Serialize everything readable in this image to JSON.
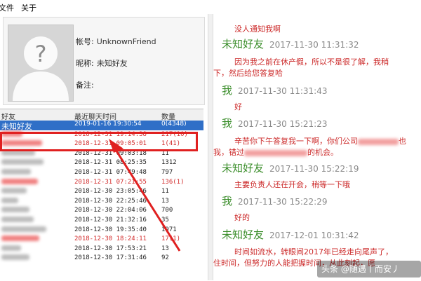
{
  "menu": {
    "file": "文件",
    "about": "关于"
  },
  "profile": {
    "account_label": "帐号:",
    "account_value": "UnknownFriend",
    "nickname_label": "昵称:",
    "nickname_value": "未知好友",
    "note_label": "备注:"
  },
  "table": {
    "columns": [
      "好友",
      "最近聊天时间",
      "数量"
    ],
    "rows": [
      {
        "name": "未知好友",
        "time": "2019-01-16 19:30:54",
        "count": "0(4348)",
        "selected": true
      },
      {
        "name": "",
        "time": "2018-12-31 19:14:38",
        "count": "217(10)",
        "red": true
      },
      {
        "name": "",
        "time": "2018-12-31 09:05:01",
        "count": "1(41)",
        "red": true
      },
      {
        "name": "",
        "time": "2018-12-31 09:03:18",
        "count": "11"
      },
      {
        "name": "",
        "time": "2018-12-31 08:25:35",
        "count": "1312"
      },
      {
        "name": "",
        "time": "2018-12-31 07:49:48",
        "count": "797"
      },
      {
        "name": "",
        "time": "2018-12-31 07:21:55",
        "count": "136(1)",
        "red": true
      },
      {
        "name": "",
        "time": "2018-12-30 23:05:46",
        "count": "11"
      },
      {
        "name": "",
        "time": "2018-12-30 22:25:46",
        "count": "13"
      },
      {
        "name": "",
        "time": "2018-12-30 22:04:06",
        "count": "700"
      },
      {
        "name": "",
        "time": "2018-12-30 21:32:16",
        "count": "35"
      },
      {
        "name": "",
        "time": "2018-12-30 19:35:40",
        "count": "1971"
      },
      {
        "name": "",
        "time": "2018-12-30 18:24:11",
        "count": "17(1)",
        "red": true
      },
      {
        "name": "",
        "time": "2018-12-30 17:53:21",
        "count": "13"
      },
      {
        "name": "",
        "time": "2018-12-30 17:31:46",
        "count": "92"
      }
    ]
  },
  "chat": {
    "messages": [
      {
        "text": "没人通知我啊"
      },
      {
        "sender": "未知好友",
        "time": "2017-11-30 11:31:32"
      },
      {
        "text": "因为我之前在休产假，所以不是很了解，我稍"
      },
      {
        "text": "下，然后给您答复哈"
      },
      {
        "sender": "我",
        "time": "2017-11-30 11:31:43"
      },
      {
        "text": "好"
      },
      {
        "sender": "我",
        "time": "2017-11-30 15:21:23"
      },
      {
        "text_a": "辛苦你下午答复我一下啊，你们公司",
        "text_b": "也"
      },
      {
        "text_a": "我，错过",
        "text_b": "的机会。"
      },
      {
        "sender": "未知好友",
        "time": "2017-11-30 15:22:19"
      },
      {
        "text": "主要负责人还在开会，稍等一下哦"
      },
      {
        "sender": "我",
        "time": "2017-11-30 15:22:29"
      },
      {
        "text": "好的"
      },
      {
        "sender": "未知好友",
        "time": "2017-12-01 10:31:42"
      },
      {
        "text": "时间如流水，转眼间2017年已经走向尾声了，"
      },
      {
        "text": "住时间，但努力的人能把握时间，从此刻起，愿"
      }
    ]
  },
  "watermark": "头条 @随遇丨而安丿",
  "colors": {
    "accent_red": "#e02020",
    "selected_row": "#2f6fc7",
    "sender_green": "#3a8d2a",
    "message_red": "#cc2a2a"
  }
}
